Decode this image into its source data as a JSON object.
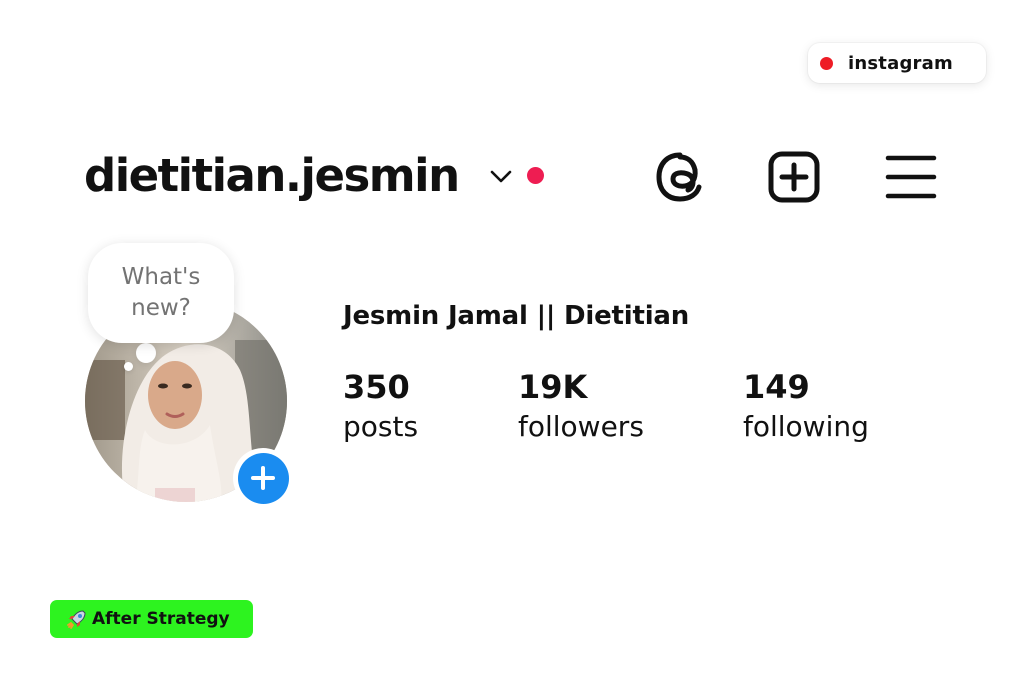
{
  "platform_tag": {
    "label": "instagram",
    "dot_color": "#ee1c25"
  },
  "header": {
    "username": "dietitian.jesmin",
    "icons": [
      "chevron-down-icon",
      "notification-dot",
      "threads-icon",
      "create-post-icon",
      "menu-icon"
    ],
    "notification_dot_color": "#ee1d52"
  },
  "note": {
    "text": "What's new?"
  },
  "profile": {
    "display_name": "Jesmin Jamal || Dietitian",
    "avatar": "profile-photo",
    "add_story_color": "#1a8cf0",
    "stats": [
      {
        "value": "350",
        "label": "posts"
      },
      {
        "value": "19K",
        "label": "followers"
      },
      {
        "value": "149",
        "label": "following"
      }
    ]
  },
  "badge": {
    "icon": "rocket-icon",
    "label": "After Strategy",
    "color": "#2df31f"
  }
}
